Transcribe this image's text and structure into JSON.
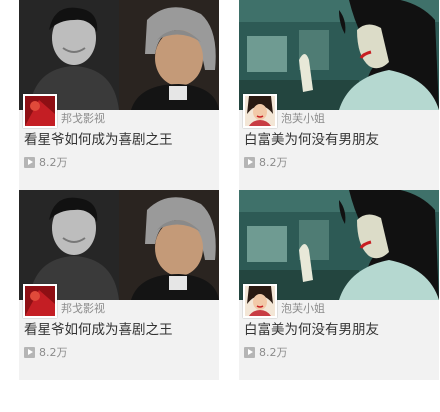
{
  "cards": [
    {
      "author": "邦戈影视",
      "title": "看星爷如何成为喜剧之王",
      "views": "8.2万",
      "thumbnail": "two-men-bw-color-photo",
      "avatar": "red-abstract-avatar"
    },
    {
      "author": "泡芙小姐",
      "title": "白富美为何没有男朋友",
      "views": "8.2万",
      "thumbnail": "cartoon-woman-teal-background",
      "avatar": "cartoon-woman-avatar"
    },
    {
      "author": "邦戈影视",
      "title": "看星爷如何成为喜剧之王",
      "views": "8.2万",
      "thumbnail": "two-men-bw-color-photo",
      "avatar": "red-abstract-avatar"
    },
    {
      "author": "泡芙小姐",
      "title": "白富美为何没有男朋友",
      "views": "8.2万",
      "thumbnail": "cartoon-woman-teal-background",
      "avatar": "cartoon-woman-avatar"
    }
  ],
  "colors": {
    "card_bg": "#f2f2f2",
    "title": "#333333",
    "meta": "#8c8c8c"
  }
}
